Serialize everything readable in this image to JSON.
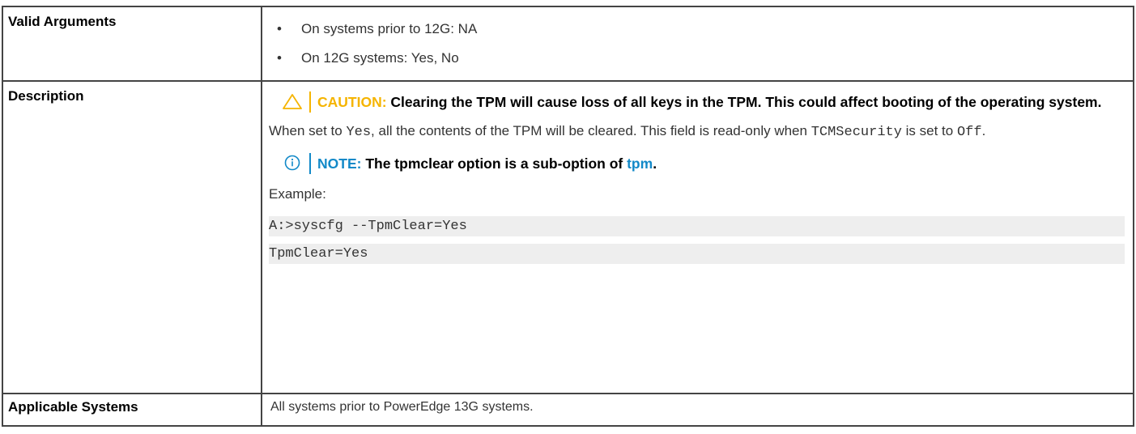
{
  "rows": {
    "valid_arguments": {
      "label": "Valid Arguments",
      "items": [
        "On systems prior to 12G: NA",
        "On 12G systems: Yes, No"
      ]
    },
    "description": {
      "label": "Description",
      "caution": {
        "tag": "CAUTION:",
        "text": "Clearing the TPM will cause loss of all keys in the TPM. This could affect booting of the operating system."
      },
      "body": {
        "part1": "When set to ",
        "code1": "Yes",
        "part2": ", all the contents of the TPM will be cleared. This field is read-only when ",
        "code2": "TCMSecurity",
        "part3": " is set to ",
        "code3": "Off",
        "part4": "."
      },
      "note": {
        "tag": "NOTE:",
        "text": "The tpmclear option is a sub-option of ",
        "link": "tpm",
        "end": "."
      },
      "example_label": "Example:",
      "code_lines": [
        "A:>syscfg --TpmClear=Yes",
        "TpmClear=Yes"
      ]
    },
    "applicable_systems": {
      "label": "Applicable Systems",
      "value": "All systems prior to PowerEdge 13G systems."
    }
  },
  "icons": {
    "caution": "warning-triangle-icon",
    "note": "info-circle-icon"
  },
  "colors": {
    "caution": "#f5b400",
    "note": "#1289c8"
  }
}
